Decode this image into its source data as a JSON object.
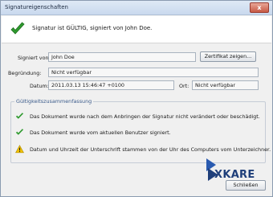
{
  "window": {
    "title": "Signatureigenschaften",
    "close_glyph": "x"
  },
  "banner": {
    "status_text": "Signatur ist GÜLTIG, signiert von John Doe."
  },
  "fields": {
    "signed_by_label": "Signiert von:",
    "signed_by_value": "John Doe",
    "reason_label": "Begründung:",
    "reason_value": "Nicht verfügbar",
    "date_label": "Datum:",
    "date_value": "2011.03.13 15:46:47 +0100",
    "location_label": "Ort:",
    "location_value": "Nicht verfügbar"
  },
  "buttons": {
    "show_certificate": "Zertifikat zeigen...",
    "close": "Schließen"
  },
  "validity": {
    "title": "Gültigkeitszusammenfassung",
    "items": [
      {
        "icon": "green-check-icon",
        "text": "Das Dokument wurde nach dem Anbringen der Signatur nicht verändert oder beschädigt."
      },
      {
        "icon": "green-check-icon",
        "text": "Das Dokument wurde vom aktuellen Benutzer signiert."
      },
      {
        "icon": "warning-icon",
        "text": "Datum und Uhrzeit der Unterschrift stammen von der Uhr des Computers vom Unterzeichner."
      }
    ]
  },
  "logo": {
    "text": "XKARE"
  },
  "colors": {
    "check_green": "#2e9a2e",
    "warning_yellow": "#f2c200",
    "accent_blue": "#1f3f7a"
  }
}
